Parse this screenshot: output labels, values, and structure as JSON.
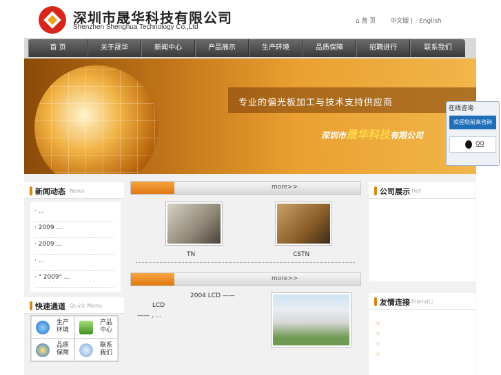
{
  "header": {
    "logo_cn": "深圳市晟华科技有限公司",
    "logo_en": "Shenzhen Shenghua Technology Co.,Ltd",
    "links": [
      "⌂ 首  页",
      "中文版 |",
      "English"
    ]
  },
  "nav": [
    "首  页",
    "关于晟华",
    "新闻中心",
    "产品展示",
    "生产环境",
    "品质保障",
    "招聘进行",
    "联系我们"
  ],
  "banner": {
    "slogan": "专业的偏光板加工与技术支持供应商",
    "company_prefix": "深圳市",
    "company_highlight": "晟华科技",
    "company_suffix": "有限公司"
  },
  "news": {
    "title": "新闻动态",
    "subtitle": "News",
    "items": [
      "·            ...",
      "·   2009    ...",
      "·   2009    ...",
      "·            ...",
      "·  \" 2009\" ..."
    ]
  },
  "quick": {
    "title": "快速通道",
    "subtitle": "Quick Menu",
    "items": [
      "生产\n环境",
      "产品\n中心",
      "品质\n保障",
      "联系\n我们"
    ]
  },
  "products": {
    "more": "more>>",
    "captions": [
      "TN",
      "CSTN"
    ]
  },
  "about": {
    "more": "more>>",
    "line1": "2004      LCD   ——",
    "line2": "LCD",
    "line3": "——       , ..."
  },
  "hot": {
    "title": "公司展示",
    "subtitle": "Hot"
  },
  "friend": {
    "title": "友情连接",
    "subtitle": "FriendLi",
    "items": [
      "☆",
      "☆",
      "☆",
      "☆"
    ]
  },
  "chat": {
    "title": "在线咨询",
    "welcome": "欢迎您前来咨询",
    "qq": "QQ"
  },
  "colors": {
    "accent": "#e07810",
    "nav_dark": "#3a3a3a",
    "logo_red": "#d8261c"
  }
}
